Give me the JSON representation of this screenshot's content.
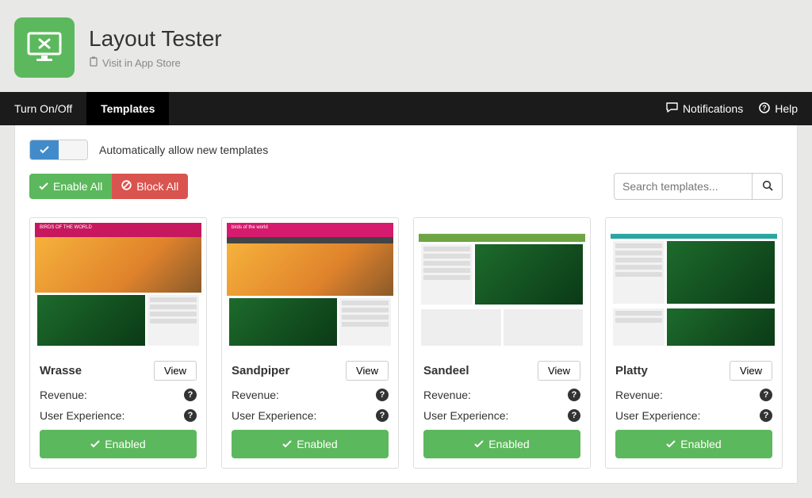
{
  "header": {
    "title": "Layout Tester",
    "store_link": "Visit in App Store"
  },
  "nav": {
    "tabs": [
      "Turn On/Off",
      "Templates"
    ],
    "active_index": 1,
    "notifications": "Notifications",
    "help": "Help"
  },
  "controls": {
    "auto_allow_label": "Automatically allow new templates",
    "enable_all": "Enable All",
    "block_all": "Block All",
    "search_placeholder": "Search templates..."
  },
  "card_labels": {
    "view": "View",
    "revenue": "Revenue:",
    "ux": "User Experience:",
    "enabled": "Enabled"
  },
  "templates": [
    {
      "name": "Wrasse"
    },
    {
      "name": "Sandpiper"
    },
    {
      "name": "Sandeel"
    },
    {
      "name": "Platty"
    }
  ]
}
